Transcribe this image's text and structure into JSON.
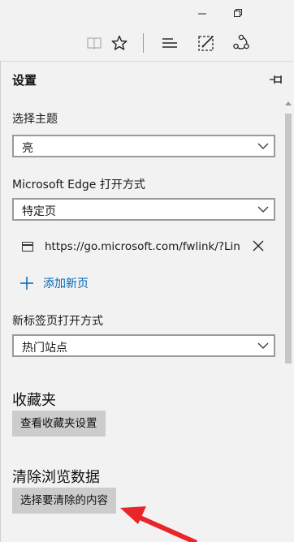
{
  "window": {
    "minimize_icon": "minimize-icon",
    "maximize_icon": "restore-icon"
  },
  "toolbar": {
    "icons": [
      "reading-view-icon",
      "favorite-star-icon",
      "hub-icon",
      "web-note-icon",
      "share-icon"
    ]
  },
  "settings": {
    "title": "设置",
    "theme": {
      "label": "选择主题",
      "value": "亮"
    },
    "open_with": {
      "label": "Microsoft Edge 打开方式",
      "value": "特定页"
    },
    "specific_page": {
      "url": "https://go.microsoft.com/fwlink/?Lin"
    },
    "add_page": {
      "label": "添加新页"
    },
    "new_tab": {
      "label": "新标签页打开方式",
      "value": "热门站点"
    },
    "favorites": {
      "heading": "收藏夹",
      "button": "查看收藏夹设置"
    },
    "clear_data": {
      "heading": "清除浏览数据",
      "button": "选择要清除的内容"
    }
  },
  "colors": {
    "accent": "#0067b8",
    "pane_background": "#f2f2f2",
    "button_background": "#cccccc",
    "annotation_arrow": "#e8262a"
  }
}
